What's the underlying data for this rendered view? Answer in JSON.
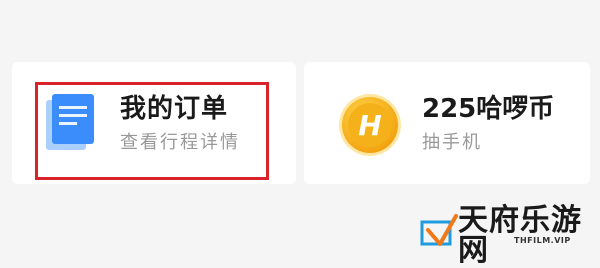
{
  "cards": [
    {
      "title": "我的订单",
      "subtitle": "查看行程详情",
      "icon": "order-document-icon",
      "accent": "#3a8dfb",
      "highlighted": true,
      "highlight_color": "#d8232a"
    },
    {
      "title": "225哈啰币",
      "subtitle": "抽手机",
      "icon": "hello-coin-icon",
      "accent": "#f8b71a",
      "coin_letter": "H"
    }
  ],
  "watermark": {
    "text": "天府乐游网",
    "url": "THFILM.VIP"
  }
}
